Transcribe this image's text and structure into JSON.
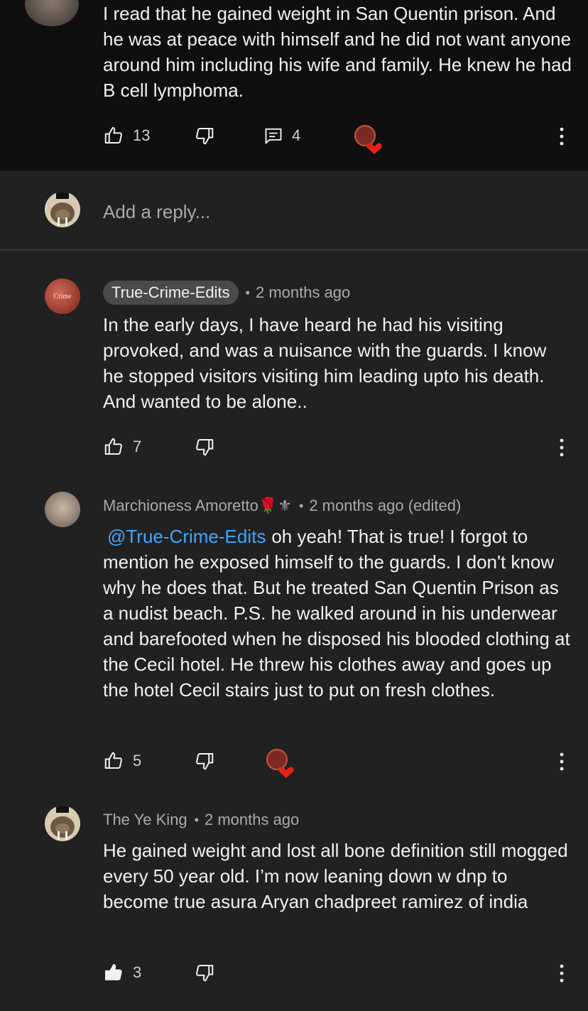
{
  "top_comment": {
    "text": "I read that he gained weight in San Quentin prison. And he was at peace with himself and he did not want anyone around him including his wife and family. He knew he had B cell lymphoma.",
    "likes": "13",
    "replies": "4"
  },
  "reply_box": {
    "placeholder": "Add a reply..."
  },
  "replies": [
    {
      "author": "True-Crime-Edits",
      "time": "2 months ago",
      "text": "In the early days, I have heard he had his visiting provoked, and was a nuisance with the guards. I know he stopped visitors visiting him leading upto his death. And wanted to be alone..",
      "likes": "7"
    },
    {
      "author": "Marchioness Amoretto🌹⚜",
      "time": "2 months ago (edited)",
      "mention": "@True-Crime-Edits",
      "text": "oh yeah! That is true! I forgot to mention he exposed himself to the guards. I don't know why he does that. But he treated San Quentin Prison as a nudist beach. P.S. he walked around in his underwear and barefooted when he disposed his blooded clothing at the Cecil hotel. He threw his clothes away and goes up the hotel Cecil stairs just to put on fresh clothes.",
      "likes": "5"
    },
    {
      "author": "The Ye King",
      "time": "2 months ago",
      "text": "He gained weight and lost all bone definition still mogged every 50 year old. I’m now leaning down w dnp to become true asura Aryan chadpreet ramirez of india",
      "likes": "3"
    }
  ],
  "colors": {
    "background": "#212121",
    "top_background": "#0f0f0f",
    "mention": "#3ea6ff",
    "heart": "#e62117"
  }
}
